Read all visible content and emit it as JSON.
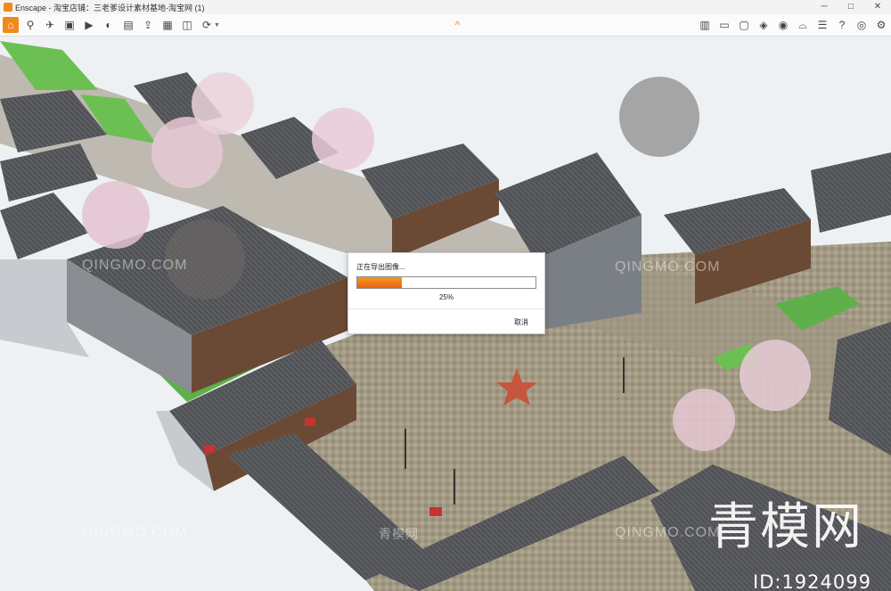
{
  "window": {
    "title": "Enscape - 淘宝店铺：三老爹设计素材基地-淘宝网 (1)",
    "minimize": "─",
    "maximize": "□",
    "close": "✕"
  },
  "toolbar": {
    "left_icons": [
      "home-icon",
      "walk-icon",
      "fly-icon",
      "screenshot-icon",
      "render-video-icon",
      "panorama-icon",
      "batch-render-icon",
      "export-icon",
      "asset-library-icon",
      "views-icon",
      "sync-icon"
    ],
    "right_icons": [
      "map-icon",
      "video-editor-icon",
      "screenshot-settings-icon",
      "cube-icon",
      "material-editor-icon",
      "vr-icon",
      "settings-icon",
      "help-icon",
      "visibility-icon",
      "gear-icon"
    ],
    "collapse_glyph": "^"
  },
  "dialog": {
    "title": "正在导出图像...",
    "progress": 0.25,
    "percent_label": "25%",
    "cancel_label": "取消"
  },
  "watermarks": {
    "small": "QINGMO.COM",
    "small_cn": "青模网",
    "big": "青模网",
    "id": "ID:1924099"
  },
  "colors": {
    "accent": "#f08a1c",
    "progress_start": "#f59a2a",
    "progress_end": "#e8620c"
  }
}
